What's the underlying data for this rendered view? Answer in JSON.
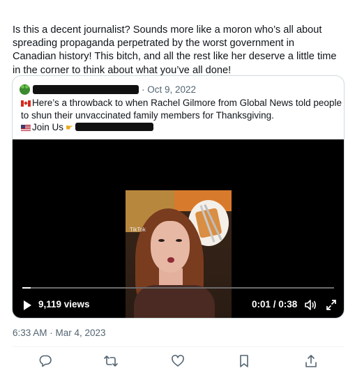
{
  "tweet": {
    "text": "Is this a decent journalist? Sounds more like a moron who’s all about spreading propaganda perpetrated by the worst government in Canadian history! This bitch, and all the rest like her deserve a little time in the corner to think about what you’ve all done!",
    "timestamp": "6:33 AM · Mar 4, 2023"
  },
  "quote": {
    "date": "· Oct 9, 2022",
    "text_line1": "Here’s a throwback to when Rachel Gilmore from Global News told people to shun their unvaccinated family members for Thanksgiving.",
    "join_label": "Join Us",
    "avatar_icon": "frog-icon",
    "flag_icon_1": "canada-flag-icon",
    "flag_icon_2": "us-flag-icon",
    "hand_icon": "pointing-hand-icon"
  },
  "video": {
    "views": "9,119 views",
    "time": "0:01 / 0:38",
    "progress": 0.026,
    "watermark": "TikTok"
  },
  "actions": {
    "reply_icon": "reply-icon",
    "retweet_icon": "retweet-icon",
    "like_icon": "like-icon",
    "bookmark_icon": "bookmark-icon",
    "share_icon": "share-icon"
  },
  "colors": {
    "text": "#0f1419",
    "muted": "#536471",
    "border": "#cfd9de",
    "video_bg": "#000000"
  }
}
